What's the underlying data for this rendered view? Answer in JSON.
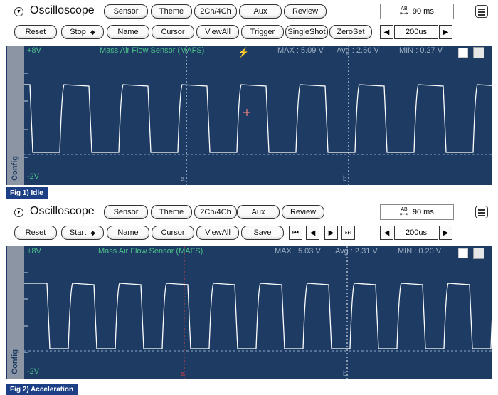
{
  "panels": [
    {
      "title": "Oscilloscope",
      "menu_row1": [
        "Sensor",
        "Theme",
        "2Ch/4Ch",
        "Aux",
        "Review"
      ],
      "timebase": "90 ms",
      "timebase_icon": "ab-arrows-icon",
      "menu_row2": [
        "Reset",
        "Stop",
        "Name",
        "Cursor",
        "ViewAll",
        "Trigger",
        "SingleShot",
        "ZeroSet"
      ],
      "scale": "200us",
      "sensor_label": "Mass Air Flow Sensor (MAFS)",
      "voltage_max_label": "+8V",
      "voltage_min_label": "-2V",
      "max_text": "MAX : 5.09 V",
      "avg_text": "Avg : 2.60 V",
      "min_text": "MIN : 0.27 V",
      "side_tab": "Config",
      "cursor_a": "a",
      "cursor_b": "b",
      "caption": "Fig 1) Idle"
    },
    {
      "title": "Oscilloscope",
      "menu_row1": [
        "Sensor",
        "Theme",
        "2Ch/4Ch",
        "Aux",
        "Review"
      ],
      "timebase": "90 ms",
      "timebase_icon": "ab-arrows-icon",
      "menu_row2": [
        "Reset",
        "Start",
        "Name",
        "Cursor",
        "ViewAll",
        "Save"
      ],
      "scale": "200us",
      "sensor_label": "Mass Air Flow Sensor (MAFS)",
      "voltage_max_label": "+8V",
      "voltage_min_label": "-2V",
      "max_text": "MAX : 5.03 V",
      "avg_text": "Avg : 2.31 V",
      "min_text": "MIN : 0.20 V",
      "side_tab": "Config",
      "cursor_a": "a",
      "cursor_b": "b",
      "caption": "Fig 2) Acceleration"
    }
  ],
  "colors": {
    "scope_bg": "#1d3b63",
    "trace": "#ffffff",
    "label_green": "#4ec18a",
    "caption_bg": "#1c3f86"
  }
}
